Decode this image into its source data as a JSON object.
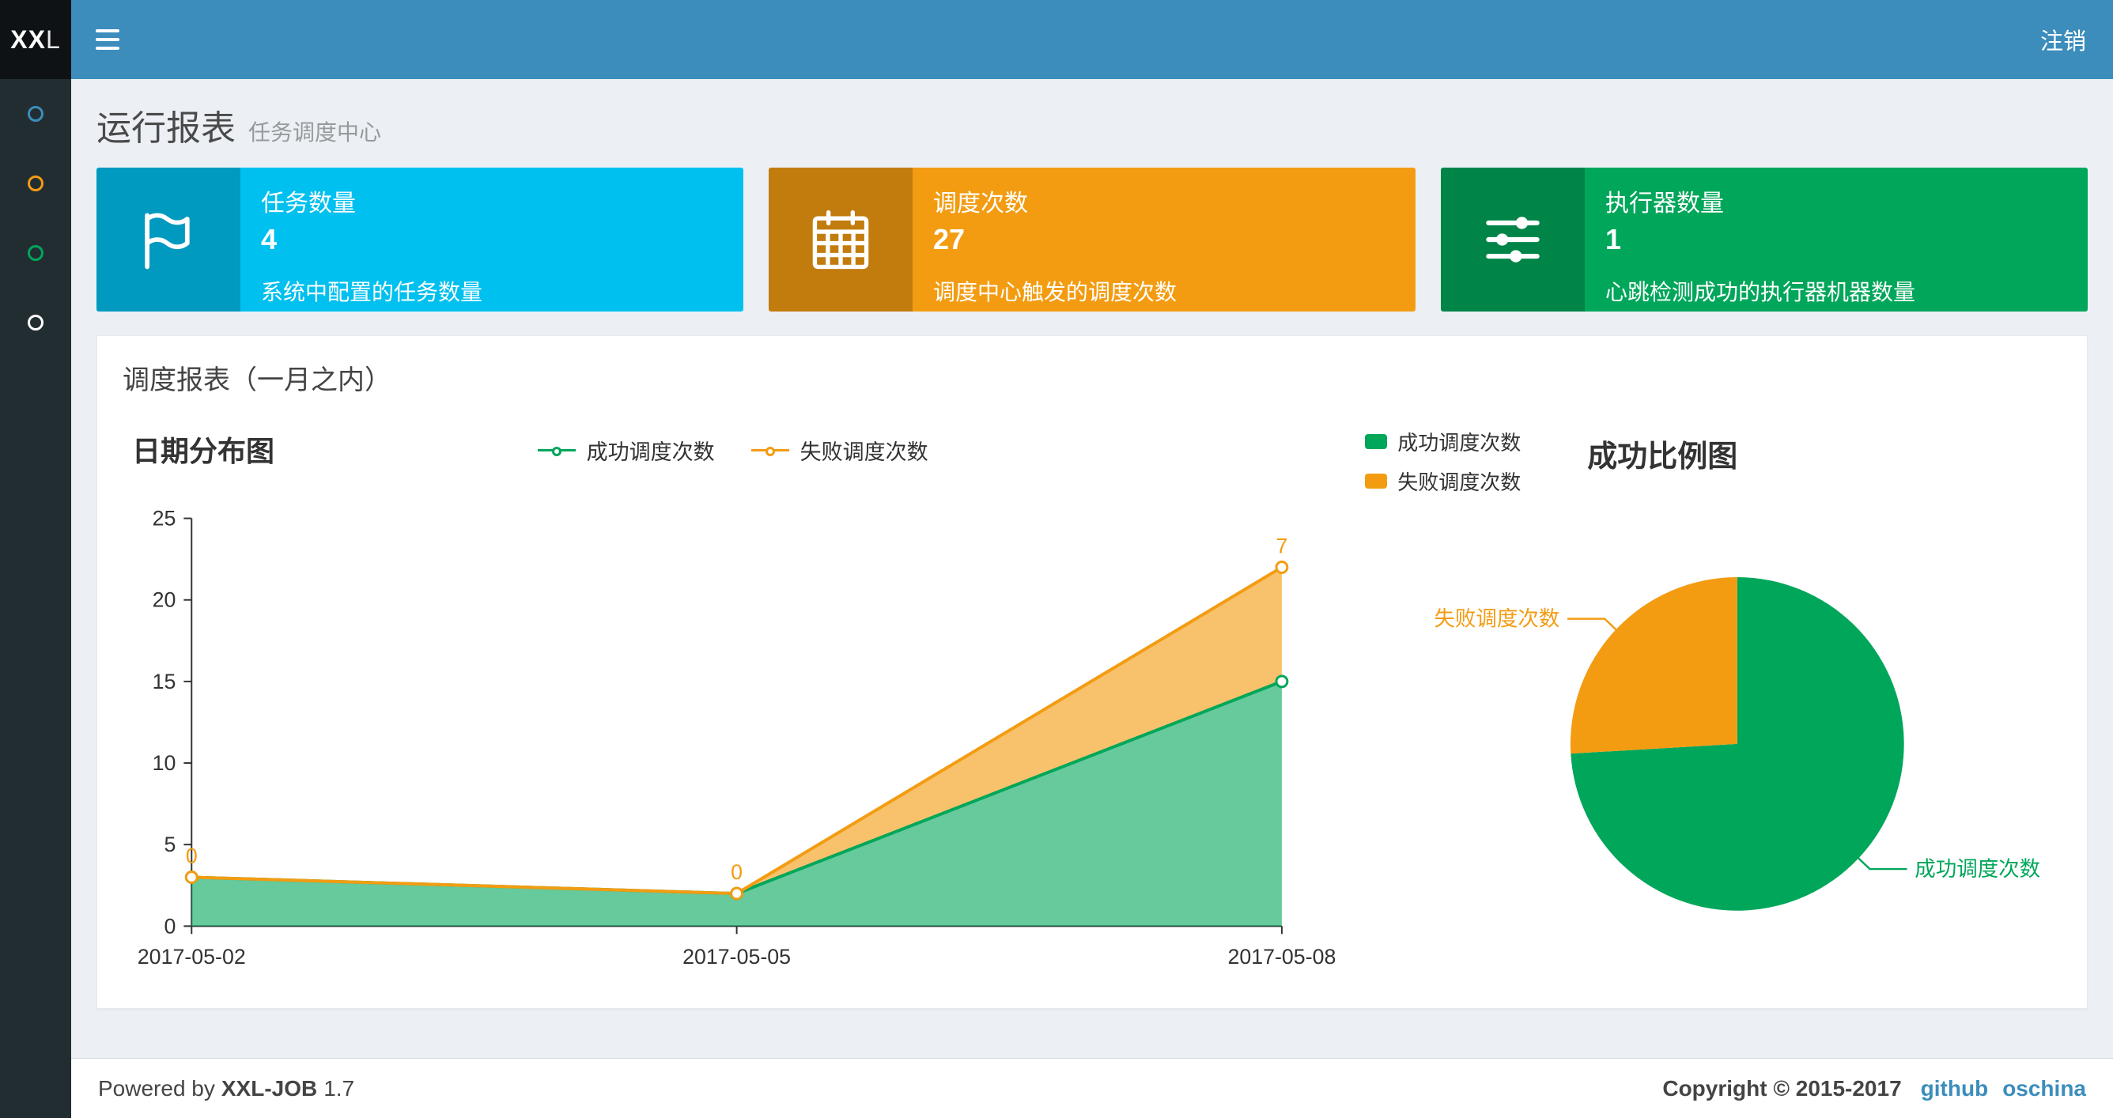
{
  "navbar": {
    "logo_bold": "XX",
    "logo_light": "L",
    "logout_label": "注销"
  },
  "sidebar": {
    "items": [
      {
        "icon": "circle-icon",
        "color": "#3c8dbc"
      },
      {
        "icon": "circle-icon",
        "color": "#f39c12"
      },
      {
        "icon": "circle-icon",
        "color": "#00a65a"
      },
      {
        "icon": "circle-icon",
        "color": "#ffffff"
      }
    ]
  },
  "header": {
    "title": "运行报表",
    "subtitle": "任务调度中心"
  },
  "info_boxes": [
    {
      "icon": "flag-icon",
      "label": "任务数量",
      "value": "4",
      "description": "系统中配置的任务数量",
      "color": "#00c0ef"
    },
    {
      "icon": "calendar-icon",
      "label": "调度次数",
      "value": "27",
      "description": "调度中心触发的调度次数",
      "color": "#f39c12"
    },
    {
      "icon": "sliders-icon",
      "label": "执行器数量",
      "value": "1",
      "description": "心跳检测成功的执行器机器数量",
      "color": "#00a65a"
    }
  ],
  "panel": {
    "title": "调度报表（一月之内）"
  },
  "chart_data": [
    {
      "type": "area",
      "title": "日期分布图",
      "categories": [
        "2017-05-02",
        "2017-05-05",
        "2017-05-08"
      ],
      "series": [
        {
          "name": "成功调度次数",
          "values": [
            3,
            2,
            15
          ],
          "color": "#00a65a"
        },
        {
          "name": "失败调度次数",
          "values": [
            0,
            0,
            7
          ],
          "color": "#f39c12",
          "point_labels": [
            "0",
            "0",
            "7"
          ]
        }
      ],
      "stacked": true,
      "xlabel": "",
      "ylabel": "",
      "ylim": [
        0,
        25
      ],
      "ytick_step": 5,
      "yticks": [
        0,
        5,
        10,
        15,
        20,
        25
      ],
      "grid": false,
      "legend_position": "top-center"
    },
    {
      "type": "pie",
      "title": "成功比例图",
      "slices": [
        {
          "name": "成功调度次数",
          "value": 20,
          "color": "#00a65a"
        },
        {
          "name": "失败调度次数",
          "value": 7,
          "color": "#f39c12"
        }
      ],
      "legend_position": "top-left"
    }
  ],
  "footer": {
    "powered_prefix": "Powered by",
    "product": "XXL-JOB",
    "version": "1.7",
    "copyright": "Copyright © 2015-2017",
    "link_github": "github",
    "link_oschina": "oschina"
  }
}
